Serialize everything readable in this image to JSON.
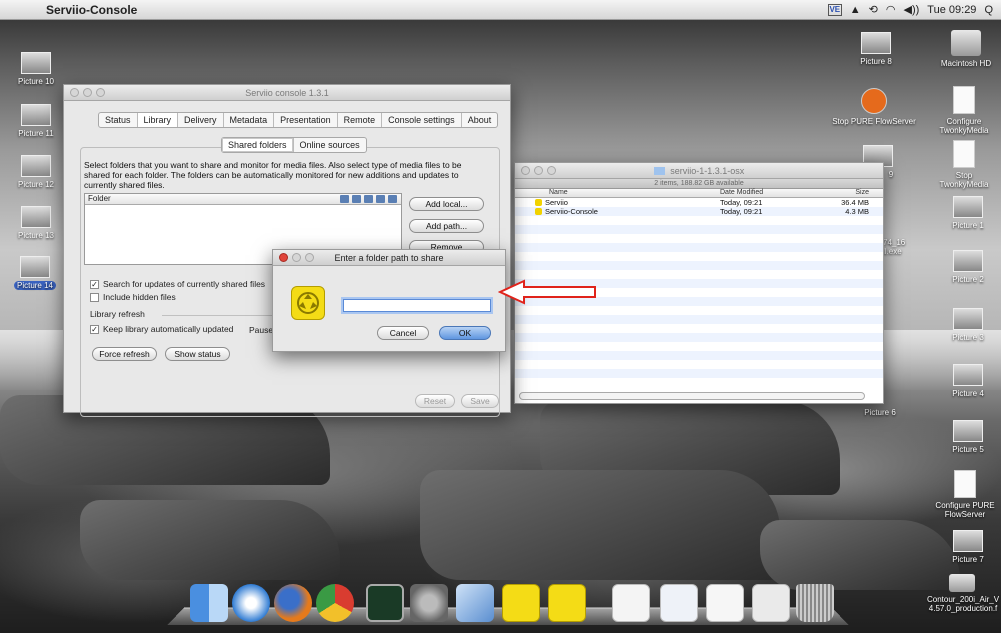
{
  "menubar": {
    "app_name": "Serviio-Console",
    "apple_glyph": "",
    "clock": "Tue 09:29",
    "search_glyph": "Q",
    "tm_text": "VE",
    "eject": "▲",
    "sync": "⟲",
    "wifi": "◠",
    "volume": "◀))"
  },
  "desktop_icons_left": [
    {
      "label": "Picture 10"
    },
    {
      "label": "Picture 11"
    },
    {
      "label": "Picture 12"
    },
    {
      "label": "Picture 13"
    },
    {
      "label": "Picture 14"
    }
  ],
  "desktop_icons_right": [
    {
      "label": "Picture 8"
    },
    {
      "label": "Macintosh HD"
    },
    {
      "label": "Stop PURE FlowServer"
    },
    {
      "label": "Configure TwonkyMedia"
    },
    {
      "label": "9"
    },
    {
      "label": "Stop TwonkyMedia"
    },
    {
      "label": "Picture 1"
    },
    {
      "label": "74_16 ll.exe"
    },
    {
      "label": "Picture 2"
    },
    {
      "label": "Picture 3"
    },
    {
      "label": "Picture 4"
    },
    {
      "label": "Picture 6"
    },
    {
      "label": "Picture 5"
    },
    {
      "label": "Configure PURE FlowServer"
    },
    {
      "label": "Picture 7"
    },
    {
      "label": "Contour_200i_Air_V 4.57.0_production.f"
    }
  ],
  "console": {
    "title": "Serviio console 1.3.1",
    "tabs": [
      "Status",
      "Library",
      "Delivery",
      "Metadata",
      "Presentation",
      "Remote",
      "Console settings",
      "About"
    ],
    "active_tab": "Library",
    "subtabs": [
      "Shared folders",
      "Online sources"
    ],
    "intro": "Select folders that you want to share and monitor for media files. Also select type of media files to be shared for each folder. The folders can be automatically monitored for new additions and updates to currently shared files.",
    "folder_header": "Folder",
    "add_local": "Add local...",
    "add_path": "Add path...",
    "remove": "Remove",
    "search_updates": "Search for updates of currently shared files",
    "include_hidden": "Include hidden files",
    "library_refresh": "Library refresh",
    "keep_updated": "Keep library automatically updated",
    "pause": "Pause",
    "force_refresh": "Force refresh",
    "show_status": "Show status",
    "reset": "Reset",
    "save": "Save",
    "check_mark": "✓"
  },
  "finder": {
    "title": "serviio-1-1.3.1-osx",
    "info": "2 items, 188.82 GB available",
    "columns": {
      "name": "Name",
      "date": "Date Modified",
      "size": "Size"
    },
    "files": [
      {
        "name": "Serviio",
        "date": "Today, 09:21",
        "size": "36.4 MB"
      },
      {
        "name": "Serviio-Console",
        "date": "Today, 09:21",
        "size": "4.3 MB"
      }
    ]
  },
  "dialog": {
    "title": "Enter a folder path to share",
    "input_value": "",
    "cancel": "Cancel",
    "ok": "OK"
  },
  "colors": {
    "arrow": "#e0231b",
    "selection": "#3a63c2",
    "serviio_yellow": "#f4dc16"
  },
  "dock": [
    "finder-icon",
    "safari-icon",
    "firefox-icon",
    "chrome-icon",
    "activity-monitor-icon",
    "system-preferences-icon",
    "preview-icon",
    "serviio-icon",
    "serviio-console-icon",
    "stack-icon",
    "stack-icon",
    "stack-icon",
    "stack-icon",
    "trash-icon"
  ]
}
